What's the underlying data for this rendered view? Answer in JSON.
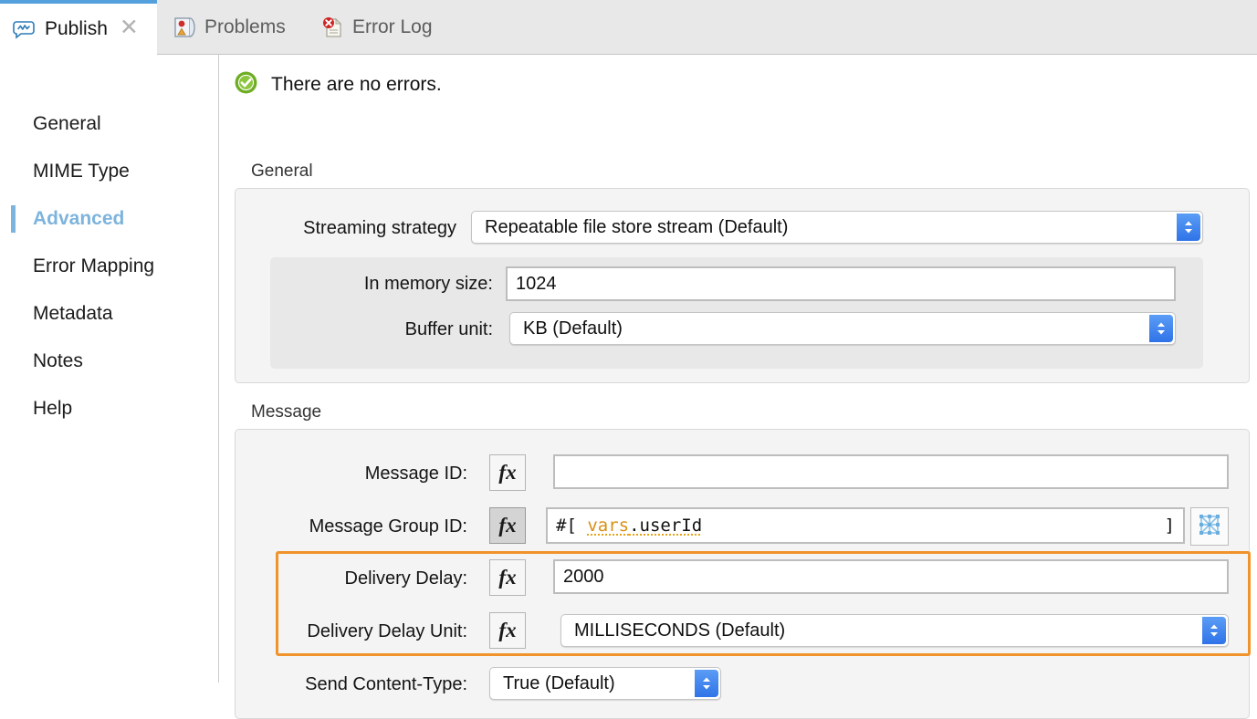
{
  "tabs": [
    {
      "label": "Publish",
      "icon": "publish-icon",
      "active": true,
      "closable": true
    },
    {
      "label": "Problems",
      "icon": "problems-icon",
      "active": false,
      "closable": false
    },
    {
      "label": "Error Log",
      "icon": "error-log-icon",
      "active": false,
      "closable": false
    }
  ],
  "sidebar": {
    "items": [
      {
        "label": "General",
        "selected": false
      },
      {
        "label": "MIME Type",
        "selected": false
      },
      {
        "label": "Advanced",
        "selected": true
      },
      {
        "label": "Error Mapping",
        "selected": false
      },
      {
        "label": "Metadata",
        "selected": false
      },
      {
        "label": "Notes",
        "selected": false
      },
      {
        "label": "Help",
        "selected": false
      }
    ]
  },
  "status": {
    "icon": "success-check-icon",
    "text": "There are no errors."
  },
  "general_group": {
    "title": "General",
    "streaming_strategy": {
      "label": "Streaming strategy",
      "value": "Repeatable file store stream (Default)"
    },
    "in_memory_size": {
      "label": "In memory size:",
      "value": "1024"
    },
    "buffer_unit": {
      "label": "Buffer unit:",
      "value": "KB (Default)"
    }
  },
  "message_group": {
    "title": "Message",
    "rows": [
      {
        "label": "Message ID:",
        "fx": "fx",
        "fx_pressed": false,
        "value": "",
        "kind": "text"
      },
      {
        "label": "Message Group ID:",
        "fx": "fx",
        "fx_pressed": true,
        "value_prefix": "#[",
        "value_token": "vars",
        "value_suffix": ".userId",
        "value_close": "]",
        "kind": "expression",
        "has_dataweave_button": true
      },
      {
        "label": "Delivery Delay:",
        "fx": "fx",
        "fx_pressed": false,
        "value": "2000",
        "kind": "text",
        "highlighted": true
      },
      {
        "label": "Delivery Delay Unit:",
        "fx": "fx",
        "fx_pressed": false,
        "value": "MILLISECONDS (Default)",
        "kind": "combo",
        "highlighted": true
      },
      {
        "label": "Send Content-Type:",
        "value": "True (Default)",
        "kind": "combo"
      }
    ]
  },
  "colors": {
    "accent_blue": "#7db4dd",
    "tab_active_top": "#54a0dd",
    "highlight_orange": "#f0932b",
    "stepper_blue": "#2f73e8",
    "expression_token": "#d89017",
    "success_green": "#7aba2b"
  }
}
